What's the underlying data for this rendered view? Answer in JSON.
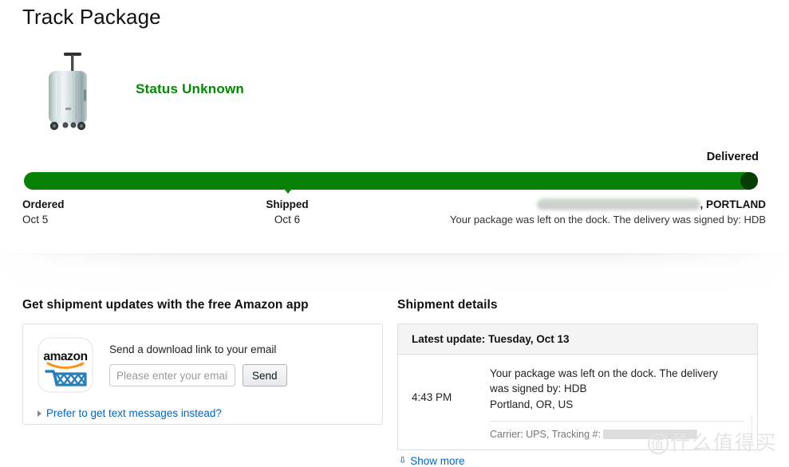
{
  "page": {
    "title": "Track Package"
  },
  "hero": {
    "product_image_alt": "silver-hardshell-suitcase",
    "status": "Status Unknown",
    "status_color": "#038704"
  },
  "tracker": {
    "final_label": "Delivered",
    "bar_color": "#068005",
    "end_dot_color": "#063d03",
    "progress_percent": 100,
    "marker_position_percent": 34,
    "milestones": [
      {
        "name": "Ordered",
        "date": "Oct 5"
      },
      {
        "name": "Shipped",
        "date": "Oct 6"
      }
    ],
    "delivered": {
      "location_redacted": true,
      "location_suffix": ", PORTLAND",
      "note": "Your package was left on the dock. The delivery was signed by: HDB"
    }
  },
  "app_section": {
    "heading": "Get shipment updates with the free Amazon app",
    "icon_name": "amazon-app-icon",
    "icon_wordmark": "amazon",
    "form_label": "Send a download link to your email",
    "email_placeholder": "Please enter your email",
    "email_value": "",
    "send_label": "Send",
    "sms_link": "Prefer to get text messages instead?"
  },
  "shipment_details": {
    "heading": "Shipment details",
    "latest_update": "Latest update: Tuesday, Oct 13",
    "events": [
      {
        "time": "4:43 PM",
        "description": "Your package was left on the dock. The delivery was signed by: HDB",
        "location": "Portland, OR, US",
        "carrier_label": "Carrier: UPS, Tracking #:",
        "tracking_redacted": true
      }
    ],
    "show_more": "Show more",
    "show_more_icon": "chevron-double-down-icon"
  },
  "watermark": {
    "circle_char": "值",
    "text": "什么值得买"
  }
}
